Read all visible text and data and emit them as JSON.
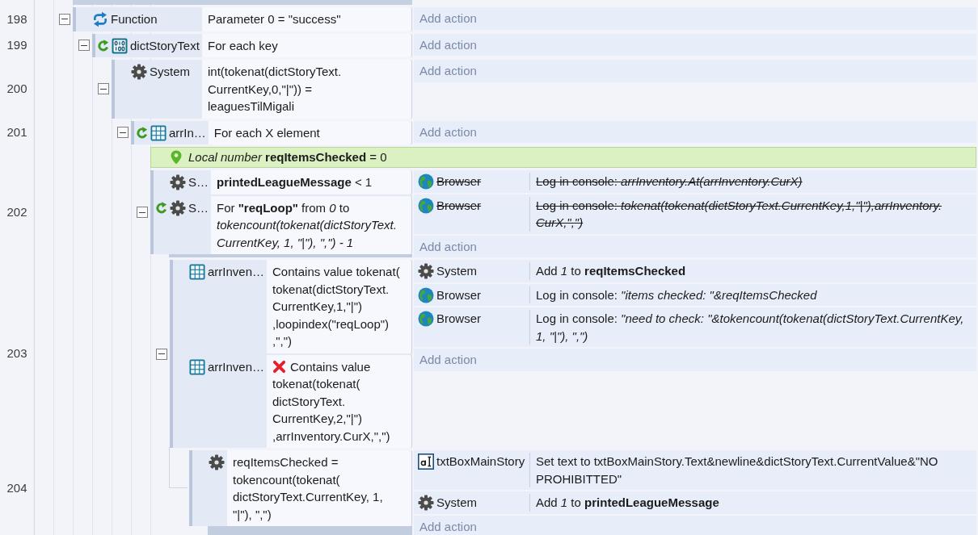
{
  "events": [
    {
      "kind": "event",
      "line": "198",
      "expanded": true,
      "conditions": [
        {
          "kind": "function",
          "loop": false,
          "object": "Function",
          "text": "Parameter 0 = \"success\"",
          "inverted": false
        }
      ],
      "add_action": "Add action",
      "children": [
        {
          "kind": "event",
          "line": "199",
          "expanded": true,
          "conditions": [
            {
              "kind": "dictionary",
              "loop": true,
              "object": "dictStoryText",
              "text": "For each key",
              "inverted": false
            }
          ],
          "add_action": "Add action",
          "children": [
            {
              "kind": "event",
              "line": "200",
              "expanded": true,
              "conditions": [
                {
                  "kind": "system",
                  "loop": false,
                  "object": "System",
                  "text": "int(tokenat(dictStoryText.CurrentKey,0,\"|\")) = leaguesTilMigali",
                  "inverted": false
                }
              ],
              "add_action": "Add action",
              "children": [
                {
                  "kind": "event",
                  "line": "201",
                  "expanded": true,
                  "conditions": [
                    {
                      "kind": "array",
                      "loop": true,
                      "object": "arrIn…",
                      "text": "For each X element",
                      "inverted": false
                    }
                  ],
                  "add_action": "Add action",
                  "children": [
                    {
                      "kind": "variable",
                      "text": "*Local number* **reqItemsChecked** = 0"
                    },
                    {
                      "kind": "event",
                      "line": "202",
                      "expanded": true,
                      "conditions": [
                        {
                          "kind": "system",
                          "loop": false,
                          "object": "S…",
                          "text": "**printedLeagueMessage** < 1",
                          "inverted": false
                        },
                        {
                          "kind": "system",
                          "loop": true,
                          "object": "S…",
                          "text": "For **\"reqLoop\"** from *0* to *tokencount(tokenat(dictStoryText.CurrentKey, 1, \"|\"), \",\") - 1*",
                          "inverted": false
                        }
                      ],
                      "actions": [
                        {
                          "kind": "browser",
                          "object": "Browser",
                          "text": "Log in console: *arrInventory.At(arrInventory.CurX)*",
                          "disabled": true
                        },
                        {
                          "kind": "browser",
                          "object": "Browser",
                          "text": "Log in console: *tokenat(tokenat(dictStoryText.CurrentKey,1,\"|\"),arrInventory.CurX,\",\")*",
                          "disabled": true
                        }
                      ],
                      "add_action": "Add action",
                      "children": [
                        {
                          "kind": "event",
                          "line": "203",
                          "expanded": true,
                          "conditions": [
                            {
                              "kind": "array",
                              "loop": false,
                              "object": "arrInven…",
                              "text": "Contains value tokenat(tokenat(dictStoryText.CurrentKey,1,\"|\"),loopindex(\"reqLoop\"),\",\")",
                              "inverted": false
                            },
                            {
                              "kind": "array",
                              "loop": false,
                              "object": "arrInven…",
                              "text": "Contains value tokenat(tokenat(dictStoryText.CurrentKey,2,\"|\"),arrInventory.CurX,\",\")",
                              "inverted": true
                            }
                          ],
                          "actions": [
                            {
                              "kind": "system",
                              "object": "System",
                              "text": "Add *1* to **reqItemsChecked**",
                              "disabled": false
                            },
                            {
                              "kind": "browser",
                              "object": "Browser",
                              "text": "Log in console: *\"items checked: \"&reqItemsChecked*",
                              "disabled": false
                            },
                            {
                              "kind": "browser",
                              "object": "Browser",
                              "text": "Log in console: *\"need to check: \"&tokencount(tokenat(dictStoryText.CurrentKey, 1, \"|\"), \",\")*",
                              "disabled": false
                            }
                          ],
                          "add_action": "Add action",
                          "children": [
                            {
                              "kind": "event",
                              "line": "204",
                              "conditions": [
                                {
                                  "kind": "system",
                                  "loop": false,
                                  "text": "reqItemsChecked = tokencount(tokenat(dictStoryText.CurrentKey, 1, \"|\"), \",\")",
                                  "inverted": false
                                }
                              ],
                              "actions": [
                                {
                                  "kind": "text",
                                  "object": "txtBoxMainStory",
                                  "text": "Set text to txtBoxMainStory.Text&newline&dictStoryText.CurrentValue&\"NO PROHIBITTED\"",
                                  "disabled": false
                                },
                                {
                                  "kind": "system",
                                  "object": "System",
                                  "text": "Add *1* to **printedLeagueMessage**",
                                  "disabled": false
                                }
                              ],
                              "add_action": "Add action"
                            }
                          ]
                        }
                      ]
                    }
                  ]
                }
              ]
            }
          ]
        }
      ]
    }
  ]
}
